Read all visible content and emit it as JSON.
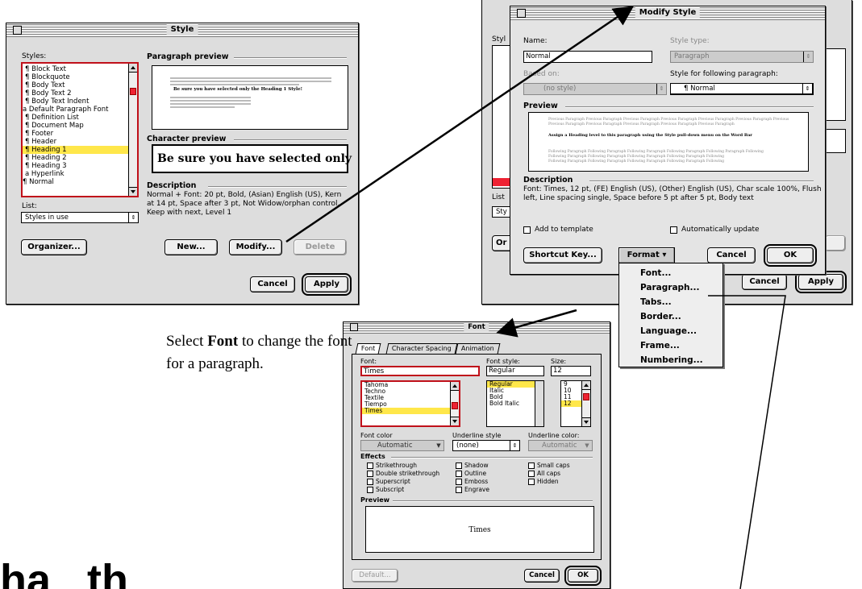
{
  "style_dialog": {
    "title": "Style",
    "styles_label": "Styles:",
    "styles": [
      "¶ Block Text",
      "¶ Blockquote",
      "¶ Body Text",
      "¶ Body Text 2",
      "¶ Body Text Indent",
      "a Default Paragraph Font",
      "¶ Definition List",
      "¶ Document Map",
      "¶ Footer",
      "¶ Header",
      "¶ Heading 1",
      "¶ Heading 2",
      "¶ Heading 3",
      "a Hyperlink",
      "¶ Normal"
    ],
    "selected_index": 10,
    "paragraph_preview_label": "Paragraph preview",
    "preview_sample": "Be sure you have selected only the Heading 1 Style!",
    "character_preview_label": "Character preview",
    "character_preview_text": "Be sure you have selected only",
    "description_label": "Description",
    "description": "Normal + Font: 20 pt, Bold, (Asian) English (US), Kern at 14 pt, Space  after 3 pt, Not Widow/orphan control, Keep with next, Level 1",
    "list_label": "List:",
    "list_value": "Styles in use",
    "organizer": "Organizer...",
    "new": "New...",
    "modify": "Modify...",
    "delete": "Delete",
    "cancel": "Cancel",
    "apply": "Apply"
  },
  "modify_dialog": {
    "title": "Modify Style",
    "name_label": "Name:",
    "name_value": "Normal",
    "style_type_label": "Style type:",
    "style_type_value": "Paragraph",
    "based_on_label": "Based on:",
    "based_on_value": "(no style)",
    "following_label": "Style for following paragraph:",
    "following_value": "¶ Normal",
    "preview_label": "Preview",
    "prev_para": "Previous Paragraph Previous Paragraph Previous Paragraph Previous Paragraph Previous Paragraph Previous Paragraph Previous",
    "sample": "Assign a Heading level to this paragraph using the Style pull-down menu on the Word Bar",
    "following_para": "Following Paragraph Following Paragraph Following Paragraph Following Paragraph Following Paragraph Following",
    "description_label": "Description",
    "description": "Font: Times, 12 pt, (FE) English (US), (Other) English (US), Char scale 100%, Flush left, Line spacing single, Space before 5 pt  after 5 pt, Body text",
    "add_template": "Add to template",
    "auto_update": "Automatically update",
    "shortcut": "Shortcut Key...",
    "format": "Format",
    "cancel": "Cancel",
    "ok": "OK"
  },
  "bg_style_dialog": {
    "styles_label": "Styl",
    "list_label": "List",
    "list_value": "Sty",
    "organizer": "Or",
    "cancel": "Cancel",
    "apply": "Apply"
  },
  "format_menu": [
    "Font...",
    "Paragraph...",
    "Tabs...",
    "Border...",
    "Language...",
    "Frame...",
    "Numbering..."
  ],
  "font_dialog": {
    "title": "Font",
    "tabs": [
      "Font",
      "Character Spacing",
      "Animation"
    ],
    "font_label": "Font:",
    "font_value": "Times",
    "fonts": [
      "Tahoma",
      "Techno",
      "Textile",
      "Tiempo",
      "Times"
    ],
    "style_label": "Font style:",
    "style_value": "Regular",
    "styles": [
      "Regular",
      "Italic",
      "Bold",
      "Bold Italic"
    ],
    "size_label": "Size:",
    "size_value": "12",
    "sizes": [
      "9",
      "10",
      "11",
      "12"
    ],
    "font_color_label": "Font color",
    "font_color_value": "Automatic",
    "underline_label": "Underline style",
    "underline_value": "(none)",
    "underline_color_label": "Underline color:",
    "underline_color_value": "Automatic",
    "effects_label": "Effects",
    "effects": [
      [
        "Strikethrough",
        "Shadow",
        "Small caps"
      ],
      [
        "Double strikethrough",
        "Outline",
        "All caps"
      ],
      [
        "Superscript",
        "Emboss",
        "Hidden"
      ],
      [
        "Subscript",
        "Engrave",
        ""
      ]
    ],
    "preview_label": "Preview",
    "preview_text": "Times",
    "default": "Default...",
    "cancel": "Cancel",
    "ok": "OK"
  },
  "caption": {
    "prefix": "Select ",
    "bold": "Font",
    "suffix": " to change the font",
    "line2": "for a paragraph."
  },
  "bottom_heading": "ha   th"
}
